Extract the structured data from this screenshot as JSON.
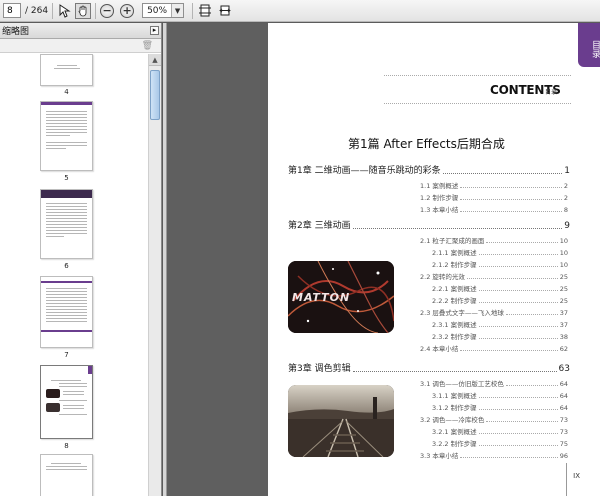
{
  "toolbar": {
    "page_current": "8",
    "page_total": "/ 264",
    "zoom": "50%",
    "icons": [
      "select-tool-icon",
      "hand-tool-icon",
      "zoom-out-icon",
      "zoom-in-icon",
      "fit-page-icon",
      "fit-width-icon"
    ]
  },
  "panel": {
    "title": "缩略图",
    "thumbs": [
      {
        "label": "4"
      },
      {
        "label": "5"
      },
      {
        "label": "6"
      },
      {
        "label": "7"
      },
      {
        "label": "8"
      }
    ]
  },
  "page": {
    "tab_text": "目录",
    "contents_title": "CONTENTS",
    "contents_sub": "目录",
    "part_title": "第1篇  After Effects后期合成",
    "page_number": "IX",
    "photo1_text": "MATTON",
    "entries": [
      {
        "kind": "ch",
        "text": "第1章  二维动画——随音乐跳动的彩条",
        "page": "1"
      },
      {
        "kind": "sub",
        "text": "1.1  案例概述",
        "page": "2"
      },
      {
        "kind": "sub",
        "text": "1.2  制作步骤",
        "page": "2"
      },
      {
        "kind": "sub",
        "text": "1.3  本章小结",
        "page": "8"
      },
      {
        "kind": "ch",
        "text": "第2章  三维动画",
        "page": "9"
      },
      {
        "kind": "sub",
        "text": "2.1  粒子汇聚成的画面",
        "page": "10"
      },
      {
        "kind": "sub2",
        "text": "2.1.1  案例概述",
        "page": "10"
      },
      {
        "kind": "sub2",
        "text": "2.1.2  制作步骤",
        "page": "10"
      },
      {
        "kind": "sub",
        "text": "2.2  旋转的光效",
        "page": "25"
      },
      {
        "kind": "sub2",
        "text": "2.2.1  案例概述",
        "page": "25"
      },
      {
        "kind": "sub2",
        "text": "2.2.2  制作步骤",
        "page": "25"
      },
      {
        "kind": "sub",
        "text": "2.3  层叠式文字——飞入地球",
        "page": "37"
      },
      {
        "kind": "sub2",
        "text": "2.3.1  案例概述",
        "page": "37"
      },
      {
        "kind": "sub2",
        "text": "2.3.2  制作步骤",
        "page": "38"
      },
      {
        "kind": "sub",
        "text": "2.4  本章小结",
        "page": "62"
      },
      {
        "kind": "ch",
        "text": "第3章  调色剪辑",
        "page": "63"
      },
      {
        "kind": "sub",
        "text": "3.1  调色——仿旧版工艺校色",
        "page": "64"
      },
      {
        "kind": "sub2",
        "text": "3.1.1  案例概述",
        "page": "64"
      },
      {
        "kind": "sub2",
        "text": "3.1.2  制作步骤",
        "page": "64"
      },
      {
        "kind": "sub",
        "text": "3.2  调色——冷库校色",
        "page": "73"
      },
      {
        "kind": "sub2",
        "text": "3.2.1  案例概述",
        "page": "73"
      },
      {
        "kind": "sub2",
        "text": "3.2.2  制作步骤",
        "page": "75"
      },
      {
        "kind": "sub",
        "text": "3.3  本章小结",
        "page": "96"
      }
    ]
  },
  "colors": {
    "accent": "#6a3d8e",
    "viewer_bg": "#5f5f5f"
  }
}
